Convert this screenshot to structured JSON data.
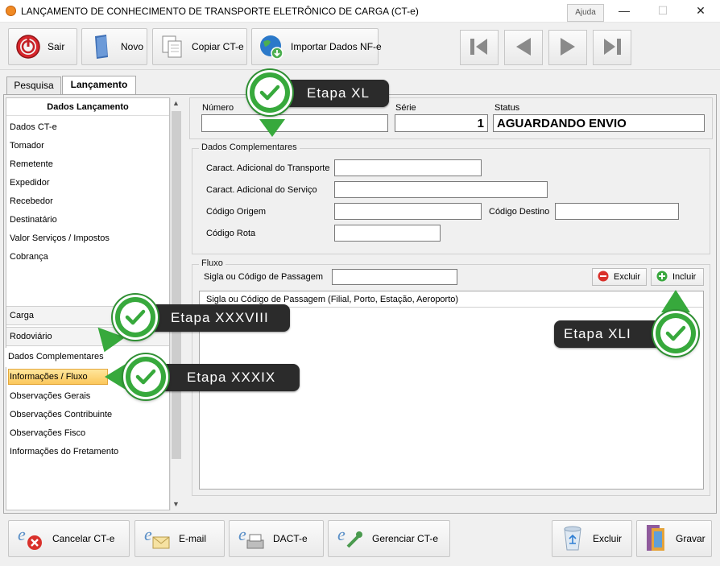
{
  "window": {
    "title": "LANÇAMENTO DE CONHECIMENTO DE TRANSPORTE ELETRÔNICO DE CARGA (CT-e)",
    "help_tooltip": "Ajuda",
    "minimize": "—",
    "maximize": "☐",
    "close": "✕"
  },
  "toolbar": {
    "sair": "Sair",
    "novo": "Novo",
    "copiar": "Copiar CT-e",
    "importar": "Importar Dados NF-e"
  },
  "tabs": [
    "Pesquisa",
    "Lançamento"
  ],
  "left_panel": {
    "header": "Dados Lançamento",
    "items": [
      "Dados CT-e",
      "Tomador",
      "Remetente",
      "Expedidor",
      "Recebedor",
      "Destinatário",
      "Valor Serviços / Impostos",
      "Cobrança"
    ],
    "groups": [
      "Carga",
      "Rodoviário",
      "Dados Complementares"
    ],
    "sub_items": [
      "Informações / Fluxo",
      "Observações Gerais",
      "Observações Contribuinte",
      "Observações Fisco",
      "Informações do Fretamento"
    ]
  },
  "header_fields": {
    "numero_label": "Número",
    "numero_value": "",
    "serie_label": "Série",
    "serie_value": "1",
    "status_label": "Status",
    "status_value": "AGUARDANDO ENVIO"
  },
  "dados_complementares": {
    "title": "Dados Complementares",
    "carac_transporte": "Caract. Adicional do Transporte",
    "carac_servico": "Caract. Adicional do Serviço",
    "codigo_origem": "Código Origem",
    "codigo_destino": "Código Destino",
    "codigo_rota": "Código Rota"
  },
  "fluxo": {
    "title": "Fluxo",
    "sigla_label": "Sigla ou Código de Passagem",
    "excluir": "Excluir",
    "incluir": "Incluir",
    "column_header": "Sigla ou Código de Passagem (Filial, Porto, Estação, Aeroporto)"
  },
  "bottom": {
    "cancelar": "Cancelar CT-e",
    "email": "E-mail",
    "dacte": "DACT-e",
    "gerenciar": "Gerenciar CT-e",
    "excluir": "Excluir",
    "gravar": "Gravar"
  },
  "callouts": {
    "xl": "Etapa XL",
    "xxxviii": "Etapa XXXVIII",
    "xxxix": "Etapa XXXIX",
    "xli": "Etapa XLI"
  },
  "colors": {
    "callout_bg": "#2b2b2b",
    "check_green": "#37a93c",
    "selected_item": "#fbc75b"
  }
}
